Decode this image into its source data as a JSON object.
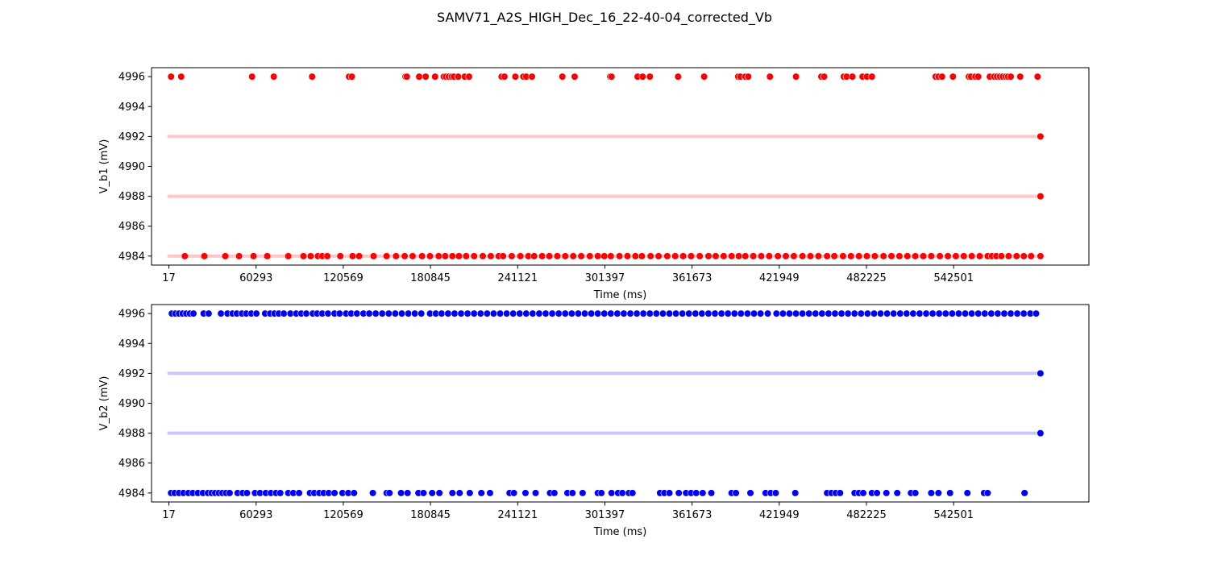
{
  "figure": {
    "title": "SAMV71_A2S_HIGH_Dec_16_22-40-04_corrected_Vb"
  },
  "chart_data": [
    {
      "type": "scatter",
      "name": "V_b1",
      "xlabel": "Time (ms)",
      "ylabel": "V_b1 (mV)",
      "xlim": [
        -12000,
        636000
      ],
      "ylim": [
        4983.4,
        4996.6
      ],
      "x_ticks": [
        17,
        60293,
        120569,
        180845,
        241121,
        301397,
        361673,
        421949,
        482225,
        542501
      ],
      "y_ticks": [
        4984,
        4986,
        4988,
        4990,
        4992,
        4994,
        4996
      ],
      "color": "#ff0000",
      "band_color": "#ffc8c8",
      "bands": [
        {
          "y": 4992,
          "x": [
            0,
            600000
          ],
          "end_point": 602500
        },
        {
          "y": 4988,
          "x": [
            0,
            600000
          ],
          "end_point": 602500
        },
        {
          "y": 4984,
          "x": [
            0,
            600000
          ],
          "end_point": 602500
        }
      ],
      "points": [
        {
          "y": 4996,
          "x": [
            1500,
            8500,
            57500,
            72500,
            99000,
            124500,
            126500,
            163500,
            164500,
            173000,
            177500,
            184000,
            190000,
            191500,
            193500,
            195500,
            197000,
            200000,
            204500,
            207500,
            230000,
            232000,
            239500,
            245000,
            247000,
            251000,
            272000,
            280500,
            305000,
            306000,
            324000,
            327500,
            332500,
            352000,
            370000,
            393500,
            395000,
            398500,
            400500,
            415500,
            433500,
            451000,
            453000,
            466500,
            468500,
            472500,
            479500,
            482500,
            486000,
            530000,
            532000,
            534500,
            542000,
            553000,
            554500,
            557500,
            559500,
            567500,
            570500,
            572500,
            574500,
            576500,
            578500,
            580000,
            582000,
            588500,
            600500
          ]
        },
        {
          "y": 4984,
          "x": [
            11000,
            24500,
            39000,
            48500,
            58500,
            68000,
            82500,
            93000,
            98000,
            103000,
            106000,
            109500,
            118500,
            127000,
            131500,
            141500,
            150500,
            157000,
            163000,
            168500,
            175000,
            180500,
            186500,
            191000,
            196000,
            200500,
            205500,
            211000,
            217000,
            222500,
            228000,
            231000,
            237000,
            243000,
            248500,
            252500,
            258000,
            263000,
            268500,
            274000,
            279500,
            285000,
            291000,
            296500,
            301000,
            305500,
            311500,
            317000,
            322500,
            327000,
            333000,
            338500,
            344500,
            350000,
            355500,
            361000,
            367000,
            373000,
            378000,
            383500,
            389000,
            394000,
            398500,
            404000,
            409500,
            415000,
            421000,
            426500,
            432000,
            438000,
            443500,
            449000,
            455000,
            460000,
            466000,
            471500,
            477000,
            482500,
            488000,
            494000,
            499500,
            505000,
            510500,
            516000,
            521500,
            527000,
            533000,
            538500,
            544000,
            549500,
            555000,
            560500,
            566000,
            569000,
            572000,
            575500,
            580500,
            586000,
            591000,
            596000
          ]
        }
      ]
    },
    {
      "type": "scatter",
      "name": "V_b2",
      "xlabel": "Time (ms)",
      "ylabel": "V_b2 (mV)",
      "xlim": [
        -12000,
        636000
      ],
      "ylim": [
        4983.4,
        4996.6
      ],
      "x_ticks": [
        17,
        60293,
        120569,
        180845,
        241121,
        301397,
        361673,
        421949,
        482225,
        542501
      ],
      "y_ticks": [
        4984,
        4986,
        4988,
        4990,
        4992,
        4994,
        4996
      ],
      "color": "#0000ff",
      "band_color": "#c8c8ff",
      "bands": [
        {
          "y": 4992,
          "x": [
            0,
            600000
          ],
          "end_point": 602500
        },
        {
          "y": 4988,
          "x": [
            0,
            600000
          ],
          "end_point": 602500
        }
      ],
      "points": [
        {
          "y": 4996,
          "x": [
            2000,
            4500,
            7000,
            9500,
            12000,
            14500,
            17000,
            24000,
            27500,
            36000,
            40500,
            44000,
            47000,
            50500,
            53500,
            57000,
            60500,
            66500,
            70000,
            73000,
            76000,
            79500,
            84000,
            88000,
            91500,
            95000,
            99500,
            102500,
            106000,
            110000,
            114500,
            118000,
            122500,
            126000,
            130000,
            134500,
            138500,
            143000,
            147500,
            152000,
            156500,
            161000,
            165500,
            170000,
            174500,
            180500,
            184500,
            188500,
            193000,
            197500,
            202000,
            206500,
            211000,
            215500,
            220000,
            224500,
            229000,
            233500,
            238000,
            242500,
            247000,
            251500,
            256000,
            260500,
            265000,
            269500,
            274000,
            278500,
            283000,
            287500,
            292000,
            296500,
            301000,
            305500,
            310000,
            314500,
            319000,
            323500,
            328000,
            332500,
            337000,
            341500,
            346000,
            350500,
            355000,
            359500,
            364000,
            368500,
            373000,
            377500,
            382000,
            386500,
            391000,
            395500,
            400000,
            404500,
            409000,
            414000,
            420000,
            424500,
            429000,
            433500,
            438000,
            442500,
            447000,
            451500,
            456000,
            460500,
            465000,
            469500,
            474000,
            478500,
            483000,
            487500,
            492000,
            496500,
            501000,
            505500,
            510000,
            514500,
            519000,
            523500,
            528000,
            532500,
            537000,
            541500,
            546000,
            550500,
            555000,
            559500,
            564000,
            568500,
            573000,
            577500,
            582000,
            586500,
            591000,
            595500,
            599500
          ]
        },
        {
          "y": 4984,
          "x": [
            1500,
            4000,
            7000,
            10000,
            13500,
            16500,
            20000,
            23500,
            27000,
            29500,
            32000,
            34500,
            37000,
            39500,
            42000,
            47500,
            51000,
            54000,
            59500,
            63000,
            67000,
            70500,
            74000,
            77000,
            82500,
            86000,
            90000,
            97500,
            100500,
            104000,
            107000,
            110500,
            114500,
            120000,
            124000,
            128000,
            141000,
            150500,
            152500,
            160500,
            165000,
            172500,
            176000,
            182000,
            187000,
            196000,
            201000,
            208000,
            216000,
            222000,
            235500,
            238500,
            246500,
            253500,
            263500,
            266500,
            275500,
            279000,
            286000,
            296500,
            299000,
            306000,
            310500,
            313500,
            318000,
            320500,
            339500,
            342500,
            346000,
            352500,
            357500,
            361000,
            364500,
            369000,
            375000,
            389000,
            392000,
            402000,
            412500,
            416000,
            419500,
            433000,
            455000,
            458000,
            461000,
            464000,
            474000,
            477000,
            480000,
            486000,
            489500,
            496000,
            503500,
            513000,
            516000,
            527000,
            532000,
            540000,
            552000,
            563500,
            566000,
            591500
          ]
        }
      ]
    }
  ]
}
